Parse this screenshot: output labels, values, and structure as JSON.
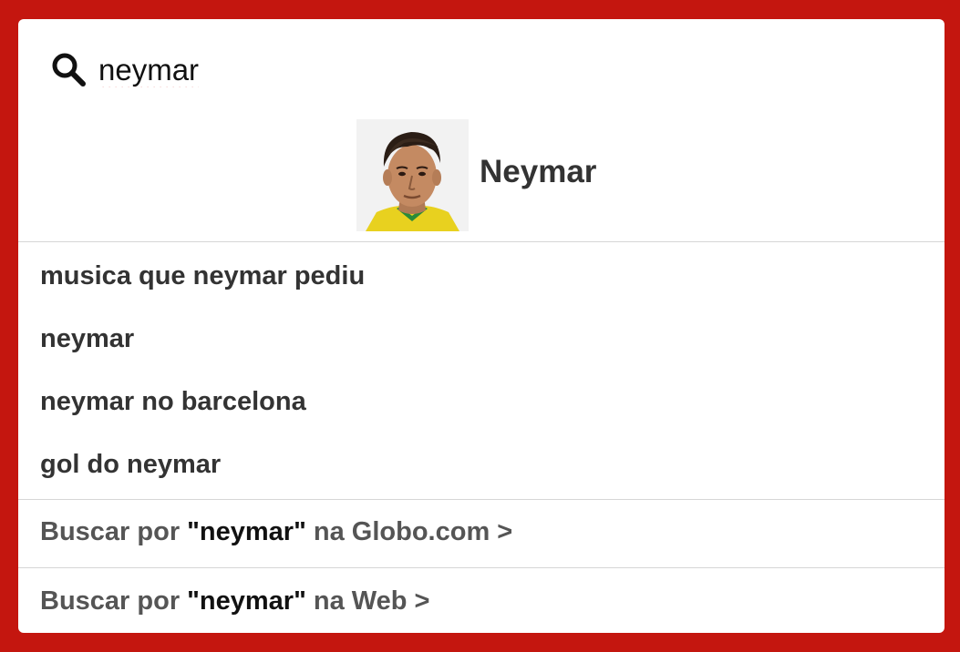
{
  "search": {
    "query": "neymar",
    "icon": "search-icon"
  },
  "featured": {
    "label": "Neymar",
    "image_icon": "person-photo"
  },
  "suggestions": [
    "musica que neymar pediu",
    "neymar",
    "neymar no barcelona",
    "gol do neymar"
  ],
  "web_searches": [
    {
      "prefix": "Buscar por ",
      "term": "\"neymar\"",
      "suffix": " na Globo.com >"
    },
    {
      "prefix": "Buscar por ",
      "term": "\"neymar\"",
      "suffix": " na Web >"
    }
  ],
  "colors": {
    "frame": "#c4160f",
    "panel": "#ffffff",
    "text": "#333333",
    "muted": "#555555",
    "divider": "#d6d6d6"
  }
}
